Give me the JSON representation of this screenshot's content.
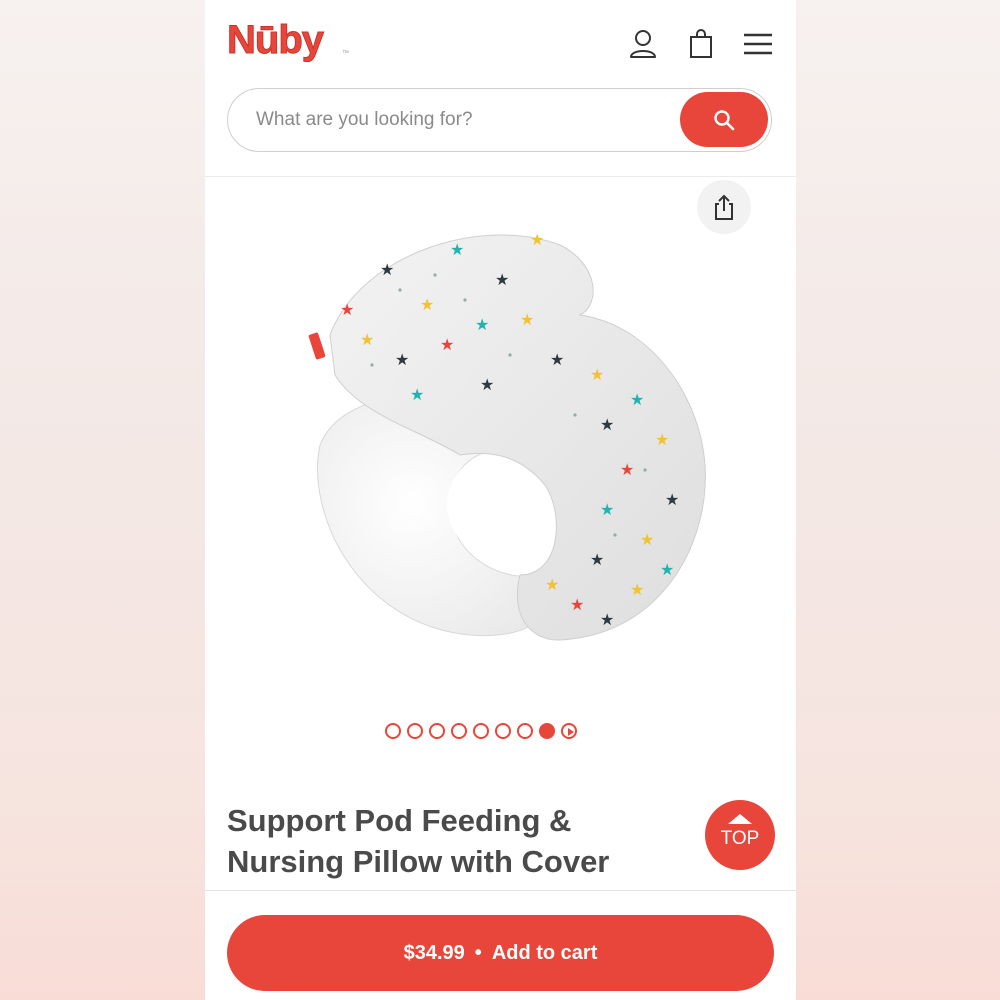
{
  "brand": {
    "logo_text": "Nūby",
    "trademark": "™",
    "color": "#e8463a"
  },
  "header": {
    "icons": [
      "account-icon",
      "bag-icon",
      "menu-icon"
    ]
  },
  "search": {
    "placeholder": "What are you looking for?",
    "value": ""
  },
  "gallery": {
    "total_slides": 9,
    "active_index": 7,
    "last_is_video": true
  },
  "product": {
    "title": "Support Pod Feeding & Nursing Pillow with Cover"
  },
  "top_button": {
    "label": "TOP"
  },
  "cart": {
    "price": "$34.99",
    "separator": "•",
    "label": "Add to cart"
  }
}
